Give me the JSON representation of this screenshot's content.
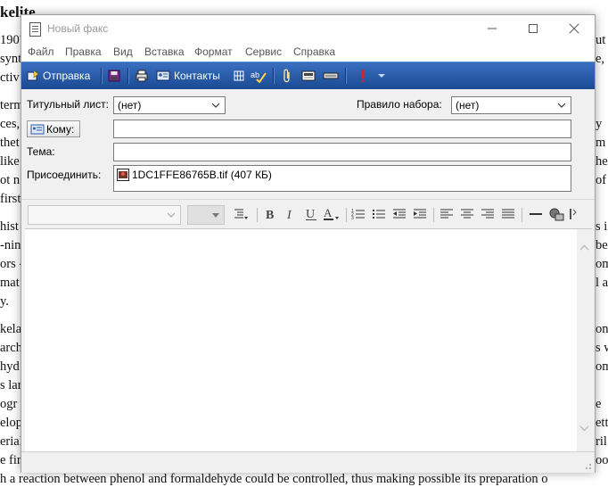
{
  "background_doc": {
    "lines": [
      "kelite",
      "1907",
      "synt",
      "ctiv",
      "term",
      "ces,",
      "thet",
      "like",
      "ot n",
      "first",
      "hist",
      "-nin",
      "ors -",
      "mat",
      "y.",
      "kela",
      "arch",
      "hyd",
      "s lar",
      "ogr",
      "elop",
      "erial",
      "e fir",
      "h a reaction between phenol and formaldehyde could be controlled, thus making possible its preparation o"
    ],
    "right_fragments": [
      "ut",
      "e, a",
      "y",
      "m",
      "he",
      "of",
      "s i",
      "be",
      "om",
      "l a",
      "on",
      "s w",
      "om",
      "e",
      "ett",
      "ril",
      "oo"
    ]
  },
  "window": {
    "title": "Новый факс"
  },
  "menu": [
    "Файл",
    "Правка",
    "Вид",
    "Вставка",
    "Формат",
    "Сервис",
    "Справка"
  ],
  "toolbar": {
    "send_label": "Отправка",
    "contacts_label": "Контакты"
  },
  "header": {
    "cover_label": "Титульный лист:",
    "cover_value": "(нет)",
    "dial_label": "Правило набора:",
    "dial_value": "(нет)",
    "to_label": "Кому:",
    "to_value": "",
    "subject_label": "Тема:",
    "subject_value": "",
    "attach_label": "Присоединить:",
    "attachment": "1DC1FFE86765B.tif (407 КБ)"
  },
  "colors": {
    "toolbar_top": "#3a6fc0",
    "toolbar_bottom": "#1c4a94",
    "chrome": "#f0f0f0"
  }
}
